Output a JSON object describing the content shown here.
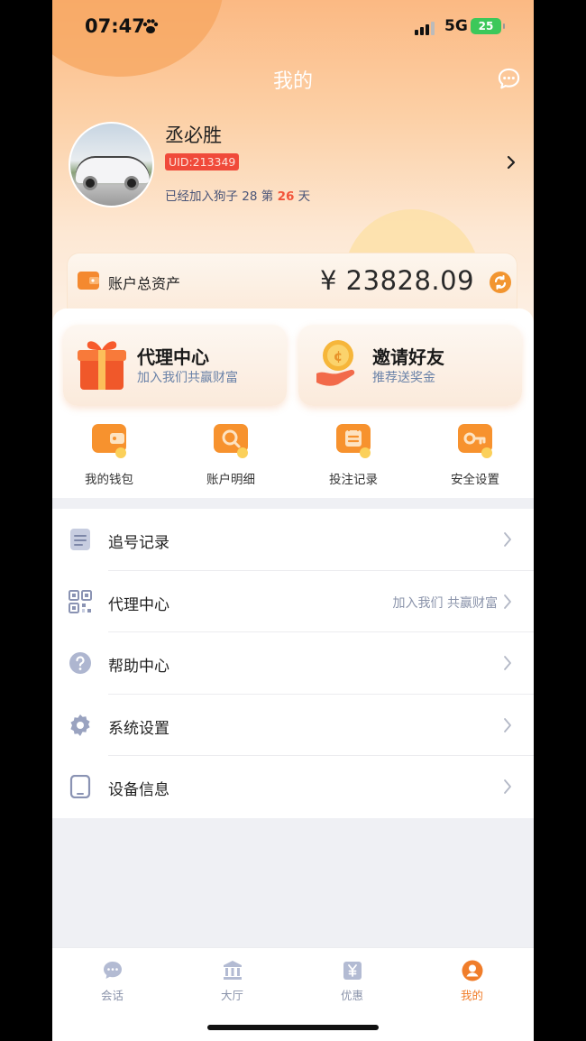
{
  "status_bar": {
    "time": "07:47",
    "network": "5G",
    "battery": "25"
  },
  "header": {
    "title": "我的",
    "message_icon": "chat-bubble-icon"
  },
  "profile": {
    "name": "丞必胜",
    "uid": "UID:213349",
    "join_prefix": "已经加入狗子 28 第",
    "join_days": "26",
    "join_suffix": "天"
  },
  "assets": {
    "label": "账户总资产",
    "value": "¥ 23828.09"
  },
  "promos": [
    {
      "title": "代理中心",
      "subtitle": "加入我们共赢财富",
      "icon": "gift-box-icon"
    },
    {
      "title": "邀请好友",
      "subtitle": "推荐送奖金",
      "icon": "hand-coin-icon"
    }
  ],
  "quick_actions": [
    {
      "label": "我的钱包",
      "icon": "wallet-icon"
    },
    {
      "label": "账户明细",
      "icon": "magnifier-icon"
    },
    {
      "label": "投注记录",
      "icon": "ticket-icon"
    },
    {
      "label": "安全设置",
      "icon": "key-icon"
    }
  ],
  "menu": [
    {
      "label": "追号记录",
      "extra": "",
      "icon": "clipboard-icon"
    },
    {
      "label": "代理中心",
      "extra": "加入我们 共赢财富",
      "icon": "qrcode-icon"
    },
    {
      "label": "帮助中心",
      "extra": "",
      "icon": "help-icon"
    },
    {
      "label": "系统设置",
      "extra": "",
      "icon": "settings-gear-icon"
    },
    {
      "label": "设备信息",
      "extra": "",
      "icon": "tablet-icon"
    }
  ],
  "tabs": [
    {
      "label": "会话",
      "icon": "chat-icon",
      "active": false
    },
    {
      "label": "大厅",
      "icon": "bank-icon",
      "active": false
    },
    {
      "label": "优惠",
      "icon": "coupon-icon",
      "active": false
    },
    {
      "label": "我的",
      "icon": "user-icon",
      "active": true
    }
  ],
  "colors": {
    "accent": "#f07d2a",
    "uid_badge": "#f04a3a",
    "header_gradient_top": "#fbb983"
  }
}
